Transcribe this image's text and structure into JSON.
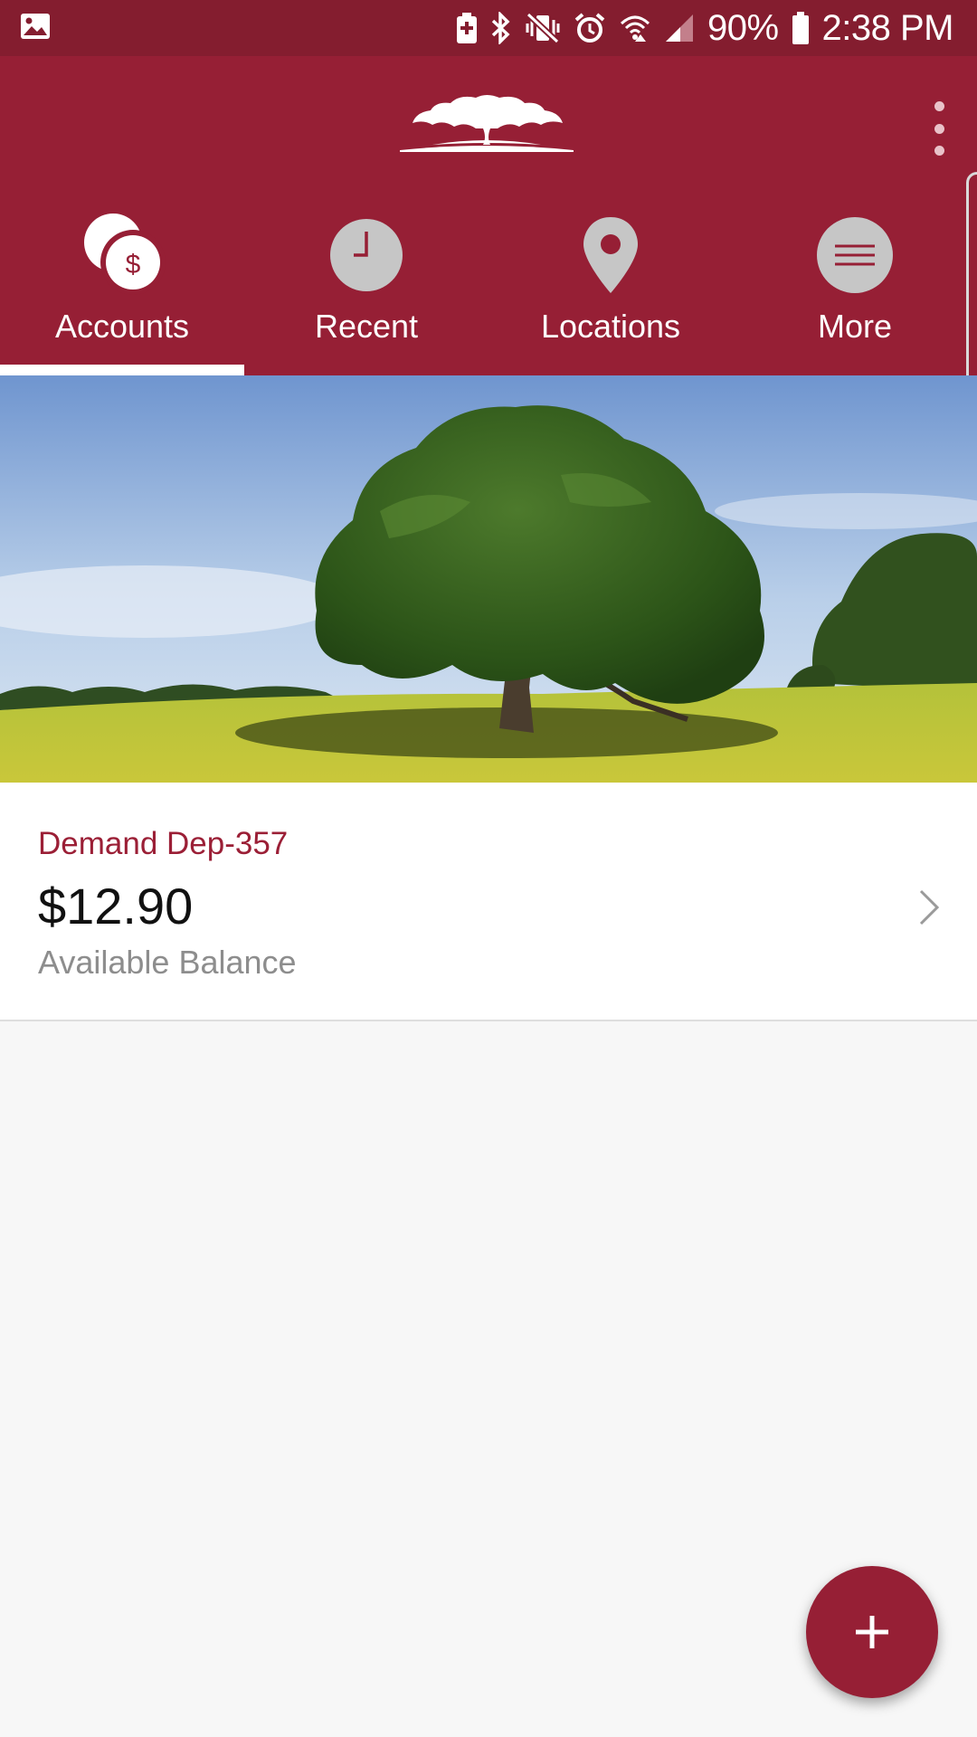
{
  "status_bar": {
    "battery_percent": "90%",
    "time": "2:38 PM",
    "icons": [
      "image-icon",
      "battery-saver-icon",
      "bluetooth-icon",
      "vibrate-icon",
      "alarm-icon",
      "wifi-icon",
      "signal-icon",
      "battery-icon"
    ]
  },
  "header": {
    "logo": "oak-tree-logo",
    "menu_icon": "more-vert-icon"
  },
  "tabs": [
    {
      "label": "Accounts",
      "icon": "accounts-coins-icon",
      "selected": true
    },
    {
      "label": "Recent",
      "icon": "clock-icon",
      "selected": false
    },
    {
      "label": "Locations",
      "icon": "location-pin-icon",
      "selected": false
    },
    {
      "label": "More",
      "icon": "menu-icon",
      "selected": false
    }
  ],
  "hero": {
    "image": "oak-tree-field"
  },
  "account": {
    "name": "Demand Dep-357",
    "balance": "$12.90",
    "balance_label": "Available Balance"
  },
  "fab": {
    "icon": "plus-icon"
  },
  "colors": {
    "brand": "#961f35",
    "status_bar": "#841d2f",
    "background": "#f7f7f7"
  }
}
